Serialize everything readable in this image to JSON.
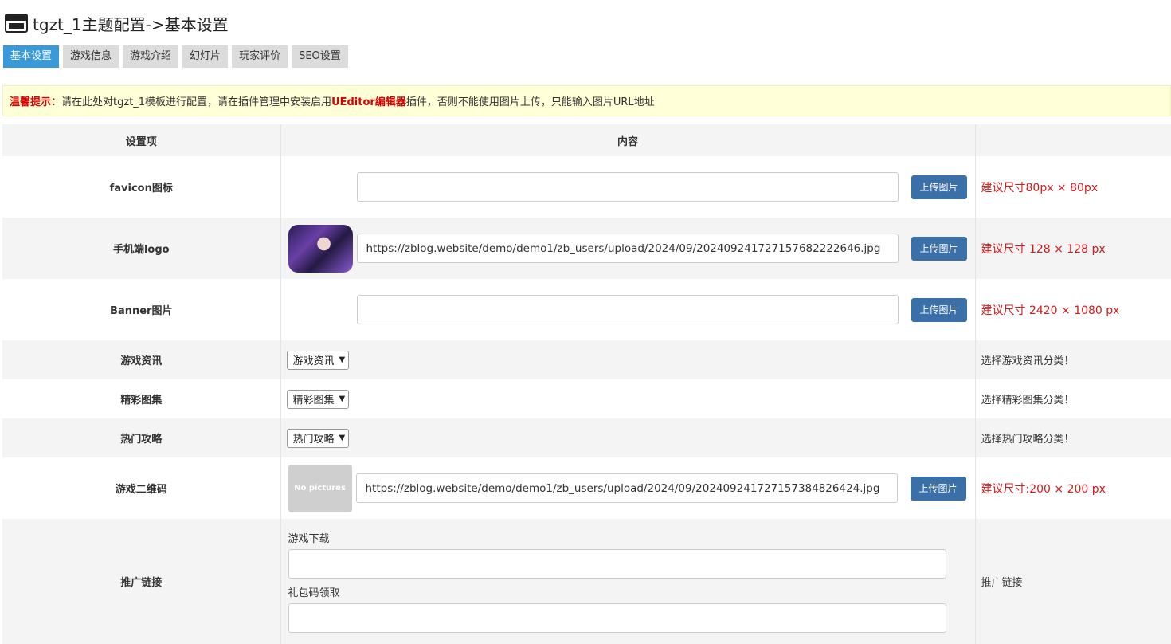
{
  "header": {
    "title": "tgzt_1主题配置->基本设置",
    "icon": "window-icon"
  },
  "tabs": [
    {
      "label": "基本设置",
      "active": true
    },
    {
      "label": "游戏信息",
      "active": false
    },
    {
      "label": "游戏介绍",
      "active": false
    },
    {
      "label": "幻灯片",
      "active": false
    },
    {
      "label": "玩家评价",
      "active": false
    },
    {
      "label": "SEO设置",
      "active": false
    }
  ],
  "notice": {
    "prefix": "温馨提示：",
    "text1": "请在此处对tgzt_1模板进行配置，请在插件管理中安装启用",
    "highlight": "UEditor编辑器",
    "text2": "插件，否则不能使用图片上传，只能输入图片URL地址"
  },
  "table": {
    "headers": [
      "设置项",
      "内容",
      ""
    ],
    "rows": {
      "favicon": {
        "label": "favicon图标",
        "value": "",
        "button": "上传图片",
        "note": "建议尺寸80px × 80px"
      },
      "mobile_logo": {
        "label": "手机端logo",
        "value": "https://zblog.website/demo/demo1/zb_users/upload/2024/09/20240924172715768222264​6.jpg",
        "button": "上传图片",
        "note": "建议尺寸 128 × 128 px"
      },
      "banner": {
        "label": "Banner图片",
        "value": "",
        "button": "上传图片",
        "note": "建议尺寸 2420 × 1080 px"
      },
      "game_news": {
        "label": "游戏资讯",
        "selected": "游戏资讯",
        "note": "选择游戏资讯分类！"
      },
      "gallery": {
        "label": "精彩图集",
        "selected": "精彩图集",
        "note": "选择精彩图集分类！"
      },
      "guides": {
        "label": "热门攻略",
        "selected": "热门攻略",
        "note": "选择热门攻略分类！"
      },
      "qrcode": {
        "label": "游戏二维码",
        "placeholder_image": "No pictures",
        "value": "https://zblog.website/demo/demo1/zb_users/upload/2024/09/202409241727157384826424.jpg",
        "button": "上传图片",
        "note": "建议尺寸:200 × 200 px"
      },
      "promo": {
        "label": "推广链接",
        "field1_label": "游戏下载",
        "field1_value": "",
        "field2_label": "礼包码领取",
        "field2_value": "",
        "note": "推广链接"
      }
    }
  },
  "colors": {
    "tab_active": "#3a9ad9",
    "upload_button": "#3a6fa8",
    "warning_red": "#d61a1a",
    "notice_bg": "#ffffd8"
  }
}
